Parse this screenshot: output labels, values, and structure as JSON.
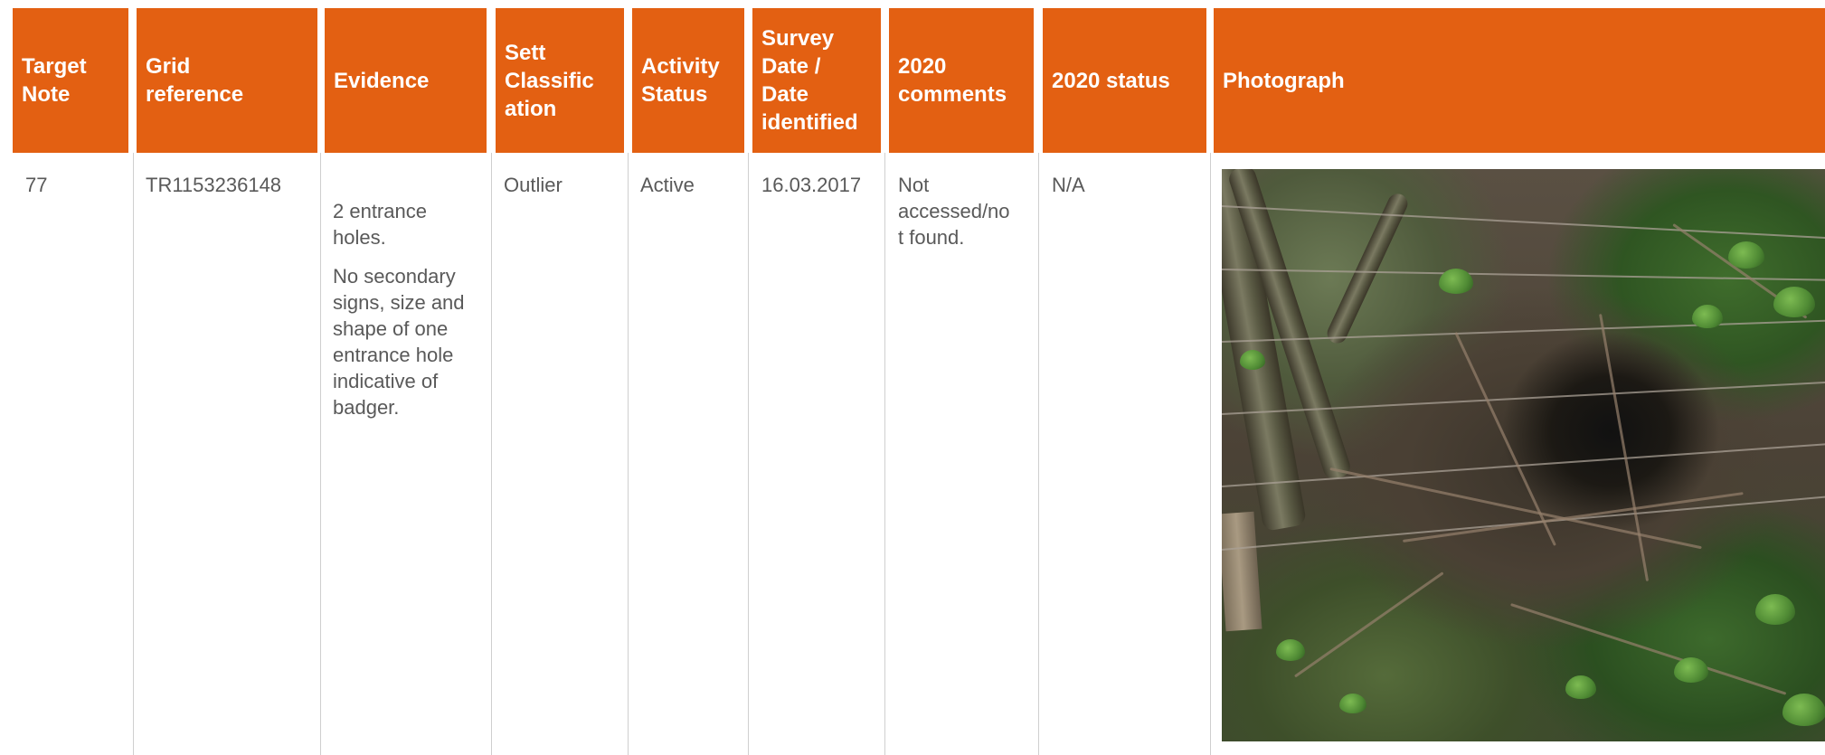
{
  "table": {
    "headers": {
      "target_note": "Target\nNote",
      "grid_reference": "Grid\nreference",
      "evidence": "Evidence",
      "sett_classification": "Sett\nClassific\nation",
      "activity_status": "Activity\nStatus",
      "survey_date": "Survey\nDate /\nDate\nidentified",
      "comments_2020": "2020\ncomments",
      "status_2020": "2020 status",
      "photograph": "Photograph"
    },
    "rows": [
      {
        "target_note": "77",
        "grid_reference": "TR1153236148",
        "evidence_p1": "2 entrance\nholes.",
        "evidence_p2": "No secondary\nsigns, size and\nshape of one\nentrance hole\nindicative of\nbadger.",
        "sett_classification": "Outlier",
        "activity_status": "Active",
        "survey_date": "16.03.2017",
        "comments_2020": "Not\naccessed/no\nt found.",
        "status_2020": "N/A",
        "photograph": "photo of badger sett entrance hole under wire fence"
      }
    ]
  },
  "colors": {
    "header_bg": "#e36012",
    "header_text": "#ffffff",
    "body_text": "#595959",
    "separator": "#cfcfcf"
  }
}
